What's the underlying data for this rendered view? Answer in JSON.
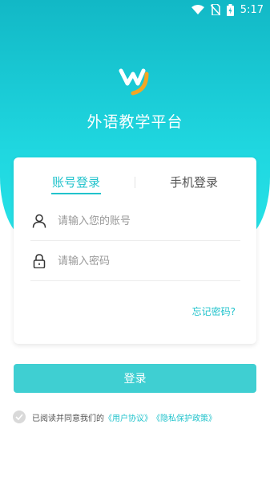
{
  "status_bar": {
    "time": "5:17"
  },
  "app": {
    "title": "外语教学平台"
  },
  "login": {
    "tabs": [
      {
        "label": "账号登录",
        "active": true
      },
      {
        "label": "手机登录",
        "active": false
      }
    ],
    "username": {
      "placeholder": "请输入您的账号",
      "value": ""
    },
    "password": {
      "placeholder": "请输入密码",
      "value": ""
    },
    "forgot_label": "忘记密码?",
    "submit_label": "登录"
  },
  "agreement": {
    "checked": false,
    "text": "已阅读并同意我们的",
    "user_agreement": "《用户协议》",
    "privacy_policy": "《隐私保护政策》"
  },
  "colors": {
    "accent": "#22c3cc",
    "button": "#3fcfd2",
    "gradient_top": "#12b8c6",
    "gradient_bottom": "#27e3e8"
  }
}
